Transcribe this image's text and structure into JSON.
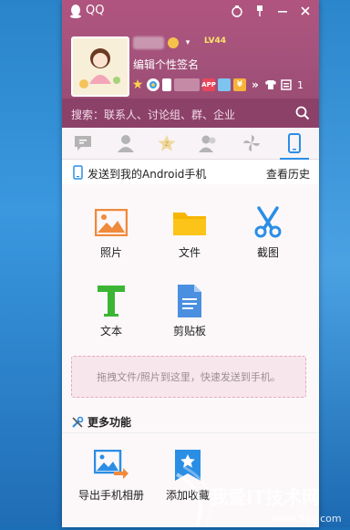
{
  "window": {
    "title": "QQ"
  },
  "profile": {
    "level": "LV44",
    "signature": "编辑个性签名",
    "count": "1"
  },
  "search": {
    "placeholder": "搜索：联系人、讨论组、群、企业"
  },
  "tabs": [
    {
      "icon": "chat-icon"
    },
    {
      "icon": "contact-icon"
    },
    {
      "icon": "star-icon"
    },
    {
      "icon": "group-icon"
    },
    {
      "icon": "pinwheel-icon"
    },
    {
      "icon": "phone-icon",
      "active": true
    }
  ],
  "send_to_phone": {
    "label": "发送到我的Android手机",
    "history": "查看历史"
  },
  "features": [
    {
      "label": "照片",
      "icon": "photo-icon"
    },
    {
      "label": "文件",
      "icon": "folder-icon"
    },
    {
      "label": "截图",
      "icon": "scissors-icon"
    },
    {
      "label": "文本",
      "icon": "text-icon"
    },
    {
      "label": "剪贴板",
      "icon": "clipboard-icon"
    }
  ],
  "dropzone": {
    "text": "拖拽文件/照片到这里，快速发送到手机。"
  },
  "more": {
    "title": "更多功能",
    "items": [
      {
        "label": "导出手机相册",
        "icon": "export-album-icon"
      },
      {
        "label": "添加收藏",
        "icon": "add-favorite-icon"
      }
    ]
  },
  "watermark": {
    "brand": "我爱IT技术网",
    "url": "www.52ij.com"
  },
  "colors": {
    "header": "#a5537c",
    "searchbar": "#8c4169",
    "accent": "#2b8ee5"
  }
}
